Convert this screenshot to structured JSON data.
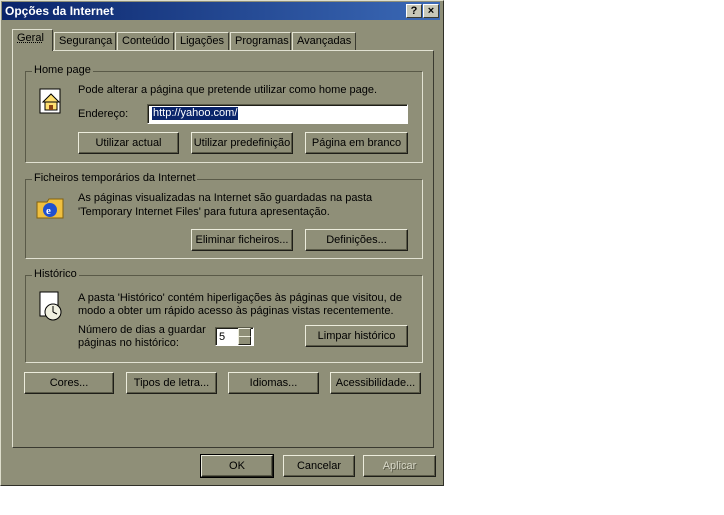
{
  "window": {
    "title": "Opções da Internet",
    "help_label": "?",
    "close_label": "×"
  },
  "tabs": [
    "Geral",
    "Segurança",
    "Conteúdo",
    "Ligações",
    "Programas",
    "Avançadas"
  ],
  "home_page": {
    "group_label": "Home page",
    "description": "Pode alterar a página que pretende utilizar como home page.",
    "address_label": "Endereço:",
    "address_value": "http://yahoo.com/",
    "buttons": [
      "Utilizar actual",
      "Utilizar predefinição",
      "Página em branco"
    ]
  },
  "temp_files": {
    "group_label": "Ficheiros temporários da Internet",
    "description_line1": "As páginas visualizadas na Internet são guardadas na pasta",
    "description_line2": "'Temporary Internet Files' para futura apresentação.",
    "buttons": [
      "Eliminar ficheiros...",
      "Definições..."
    ]
  },
  "history": {
    "group_label": "Histórico",
    "description_line1": "A pasta 'Histórico' contém hiperligações às páginas que visitou, de",
    "description_line2": "modo a obter um rápido acesso às páginas vistas recentemente.",
    "days_label_line1": "Número de dias a guardar",
    "days_label_line2": "páginas no histórico:",
    "days_value": "5",
    "clear_button": "Limpar histórico"
  },
  "bottom_buttons": [
    "Cores...",
    "Tipos de letra...",
    "Idiomas...",
    "Acessibilidade..."
  ],
  "dialog_buttons": {
    "ok": "OK",
    "cancel": "Cancelar",
    "apply": "Aplicar"
  }
}
